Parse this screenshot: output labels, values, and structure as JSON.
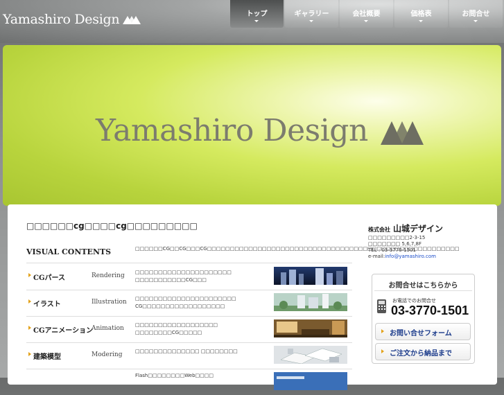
{
  "header": {
    "logo_text": "Yamashiro Design",
    "nav": [
      {
        "label": "トップ",
        "active": true
      },
      {
        "label": "ギャラリー",
        "active": false
      },
      {
        "label": "会社概要",
        "active": false
      },
      {
        "label": "価格表",
        "active": false
      },
      {
        "label": "お問合せ",
        "active": false
      }
    ]
  },
  "hero": {
    "logo_text": "Yamashiro Design"
  },
  "main": {
    "title": "□□□□□□cg□□□□cg□□□□□□□□□",
    "visual_contents_heading": "VISUAL CONTENTS",
    "visual_contents_desc": "□□□□□□CG□□CG□□□CG□□□□□□□□□□□□□□□□□□□□□□□□□□□□□□□□□□□□□□□□□□□□□□□□□□□□□□□",
    "services": [
      {
        "jp": "CGパース",
        "en": "Rendering",
        "desc": "□□□□□□□□□□□□□□□□□□□□□ □□□□□□□□□□□CG□□□",
        "image": "rendering-thumbnail"
      },
      {
        "jp": "イラスト",
        "en": "Illustration",
        "desc": "□□□□□□□□□□□□□□□□□□□□□□ CG□□□□□□□□□□□□□□□□□□",
        "image": "illustration-thumbnail"
      },
      {
        "jp": "CGアニメーション",
        "en": "Animation",
        "desc": "□□□□□□□□□□□□□□□□□□ □□□□□□□□CG□□□□□",
        "image": "animation-thumbnail"
      },
      {
        "jp": "建築模型",
        "en": "Modering",
        "desc": "□□□□□□□□□□□□□□ □□□□□□□□",
        "image": "model-thumbnail"
      },
      {
        "jp": "",
        "en": "",
        "desc": "Flash□□□□□□□□Web□□□□",
        "image": "web-thumbnail"
      }
    ]
  },
  "company": {
    "prefix": "株式会社",
    "name": "山城デザイン",
    "address1": "□□□□□□□□□2-3-15",
    "address2": "□□□□□□□ 5,6,7,8F",
    "tel": "TEL : 03-3770-1501",
    "email_label": "e-mail:",
    "email": "info@yamashiro.com"
  },
  "contact": {
    "title": "お問合せはこちらから",
    "phone_caption": "お電話でのお問合せ",
    "phone_number": "03-3770-1501",
    "form_button": "お問い合せフォーム",
    "order_button": "ご注文から納品まで"
  }
}
